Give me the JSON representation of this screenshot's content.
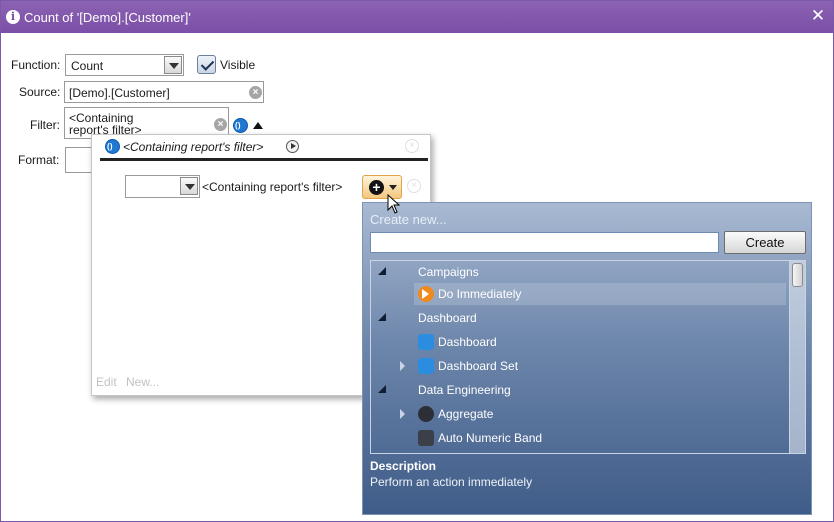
{
  "window": {
    "title": "Count of '[Demo].[Customer]'"
  },
  "form": {
    "function_label": "Function:",
    "function_value": "Count",
    "visible_label": "Visible",
    "source_label": "Source:",
    "source_value": "[Demo].[Customer]",
    "filter_label": "Filter:",
    "filter_value_line1": "<Containing",
    "filter_value_line2": "report's filter>",
    "format_label": "Format:"
  },
  "filter_popup": {
    "header": "<Containing report's filter>",
    "row_select_value": "",
    "row_label": "<Containing report's filter>",
    "edit_link": "Edit",
    "new_link": "New..."
  },
  "create_panel": {
    "title": "Create new...",
    "search_value": "",
    "create_button": "Create",
    "items": [
      {
        "label": "Campaigns",
        "kind": "group",
        "expanded": true
      },
      {
        "label": "Do Immediately",
        "kind": "item",
        "icon": "action-arrow-icon",
        "selected": true
      },
      {
        "label": "Dashboard",
        "kind": "group",
        "expanded": true
      },
      {
        "label": "Dashboard",
        "kind": "item",
        "icon": "dashboard-icon"
      },
      {
        "label": "Dashboard Set",
        "kind": "item",
        "icon": "dashboard-set-icon",
        "has_children": true
      },
      {
        "label": "Data Engineering",
        "kind": "group",
        "expanded": true
      },
      {
        "label": "Aggregate",
        "kind": "item",
        "icon": "aggregate-icon",
        "has_children": true
      },
      {
        "label": "Auto Numeric Band",
        "kind": "item",
        "icon": "numeric-band-icon"
      }
    ],
    "description_heading": "Description",
    "description_text": "Perform an action immediately"
  },
  "colors": {
    "title_bar": "#8c62b3",
    "panel_top": "#a9bad2",
    "panel_bottom": "#3f5c88",
    "add_button": "#f3c77e"
  }
}
